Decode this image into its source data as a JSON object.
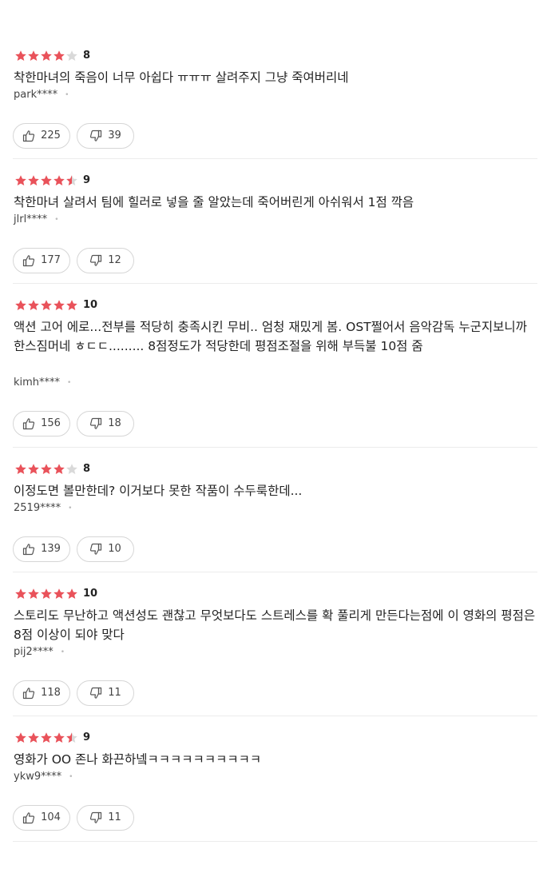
{
  "reviews": [
    {
      "rating": 4,
      "score": "8",
      "text": "착한마녀의 죽음이 너무 아쉽다 ㅠㅠㅠ 살려주지 그냥 죽여버리네",
      "author": "park****",
      "likes": "225",
      "dislikes": "39"
    },
    {
      "rating": 4.5,
      "score": "9",
      "text": "착한마녀 살려서 팀에 힐러로 넣을 줄 알았는데 죽어버린게 아쉬워서 1점 깍음",
      "author": "jlrl****",
      "likes": "177",
      "dislikes": "12"
    },
    {
      "rating": 5,
      "score": "10",
      "text": "액션 고어 에로...전부를 적당히 충족시킨 무비.. 엄청 재밌게 봄. OST쩔어서 음악감독 누군지보니까 한스짐머네 ㅎㄷㄷ......... 8점정도가 적당한데 평점조절을 위해 부득불 10점 줌",
      "author": "kimh****",
      "likes": "156",
      "dislikes": "18"
    },
    {
      "rating": 4,
      "score": "8",
      "text": "이정도면 볼만한데? 이거보다 못한 작품이 수두룩한데...",
      "author": "2519****",
      "likes": "139",
      "dislikes": "10"
    },
    {
      "rating": 5,
      "score": "10",
      "text": "스토리도 무난하고 액션성도 괜찮고 무엇보다도 스트레스를 확 풀리게 만든다는점에 이 영화의 평점은 8점 이상이 되야 맞다",
      "author": "pij2****",
      "likes": "118",
      "dislikes": "11"
    },
    {
      "rating": 4.5,
      "score": "9",
      "text": "영화가 OO 존나 화끈하넼ㅋㅋㅋㅋㅋㅋㅋㅋㅋㅋ",
      "author": "ykw9****",
      "likes": "104",
      "dislikes": "11"
    }
  ],
  "author_separator": "•",
  "icons": {
    "like": "thumbs-up-icon",
    "dislike": "thumbs-down-icon",
    "star": "star-icon"
  },
  "colors": {
    "star_filled": "#e9525a",
    "star_empty": "#d9d9d9",
    "divider": "#ececec",
    "button_border": "#d6d6d6"
  }
}
